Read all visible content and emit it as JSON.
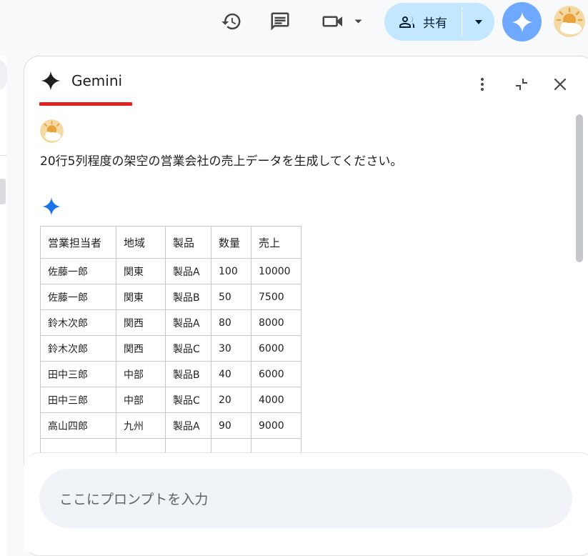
{
  "toolbar": {
    "history_icon": "history-icon",
    "comment_icon": "comment-icon",
    "meet_icon": "video-camera-icon",
    "share_label": "共有",
    "share_icon": "people-icon"
  },
  "panel": {
    "title": "Gemini",
    "more_icon": "more-vert-icon",
    "collapse_icon": "collapse-icon",
    "close_icon": "close-icon"
  },
  "conversation": {
    "user_message": "20行5列程度の架空の営業会社の売上データを生成してください。"
  },
  "table": {
    "headers": [
      "営業担当者",
      "地域",
      "製品",
      "数量",
      "売上"
    ],
    "rows": [
      [
        "佐藤一郎",
        "関東",
        "製品A",
        "100",
        "10000"
      ],
      [
        "佐藤一郎",
        "関東",
        "製品B",
        "50",
        "7500"
      ],
      [
        "鈴木次郎",
        "関西",
        "製品A",
        "80",
        "8000"
      ],
      [
        "鈴木次郎",
        "関西",
        "製品C",
        "30",
        "6000"
      ],
      [
        "田中三郎",
        "中部",
        "製品B",
        "40",
        "6000"
      ],
      [
        "田中三郎",
        "中部",
        "製品C",
        "20",
        "4000"
      ],
      [
        "高山四郎",
        "九州",
        "製品A",
        "90",
        "9000"
      ]
    ]
  },
  "input": {
    "placeholder": "ここにプロンプトを入力"
  },
  "colors": {
    "accent": "#0b57d0",
    "share_bg": "#c2e7ff",
    "gemini_button": "#6fa8ff",
    "underline": "#e02020"
  }
}
